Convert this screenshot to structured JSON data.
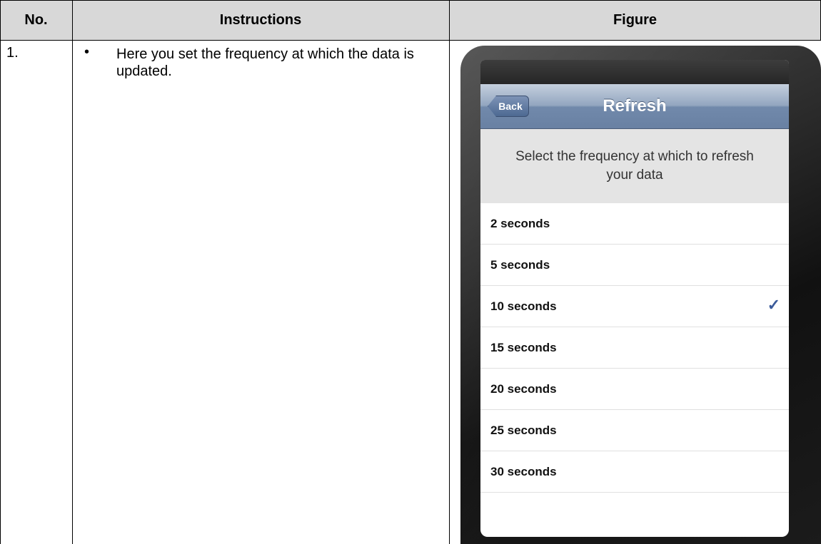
{
  "table": {
    "headers": [
      "No.",
      "Instructions",
      "Figure"
    ],
    "rows": [
      {
        "no": "1.",
        "bullet": "•",
        "instruction": "Here you set the frequency at which the data is updated."
      }
    ]
  },
  "device": {
    "nav": {
      "back_label": "Back",
      "title": "Refresh"
    },
    "description": "Select the frequency at which to refresh your data",
    "options": [
      {
        "label": "2 seconds",
        "selected": false
      },
      {
        "label": "5 seconds",
        "selected": false
      },
      {
        "label": "10 seconds",
        "selected": true
      },
      {
        "label": "15 seconds",
        "selected": false
      },
      {
        "label": "20 seconds",
        "selected": false
      },
      {
        "label": "25 seconds",
        "selected": false
      },
      {
        "label": "30 seconds",
        "selected": false
      }
    ],
    "check_glyph": "✓"
  },
  "colors": {
    "header_bg": "#d8d8d8",
    "nav_accent": "#6981a3",
    "check": "#3b5b9a"
  }
}
